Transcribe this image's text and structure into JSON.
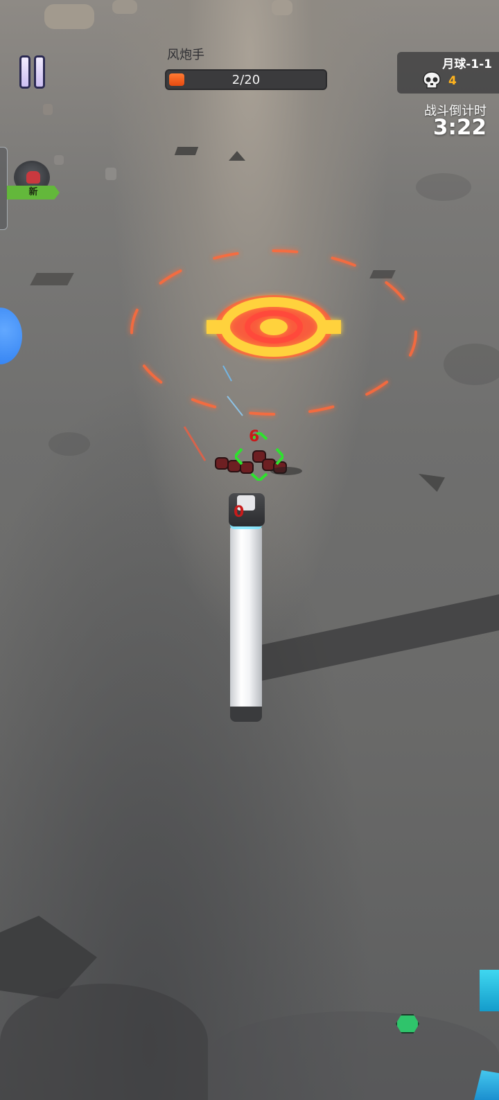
{
  "hud": {
    "enemy_type": "风炮手",
    "wave_progress": "2/20",
    "wave_fraction": 0.1,
    "level_name": "月球-1-1",
    "kill_count": "4",
    "countdown_label": "战斗倒计时",
    "countdown_time": "3:22"
  },
  "side_panel": {
    "new_tag": "新"
  },
  "battlefield": {
    "enemy_squad_count": "6",
    "tower_count": "0"
  },
  "icons": {
    "pause": "pause-icon",
    "skull": "skull-icon",
    "gem": "hex-gem-icon"
  },
  "colors": {
    "wave_fill": "#ff6a22",
    "kill_count": "#ffb41e",
    "counter_red": "#c81b1b",
    "target_green": "#2ee22e",
    "danger_zone": "#ff6a3a",
    "new_tag": "#63b83b"
  }
}
